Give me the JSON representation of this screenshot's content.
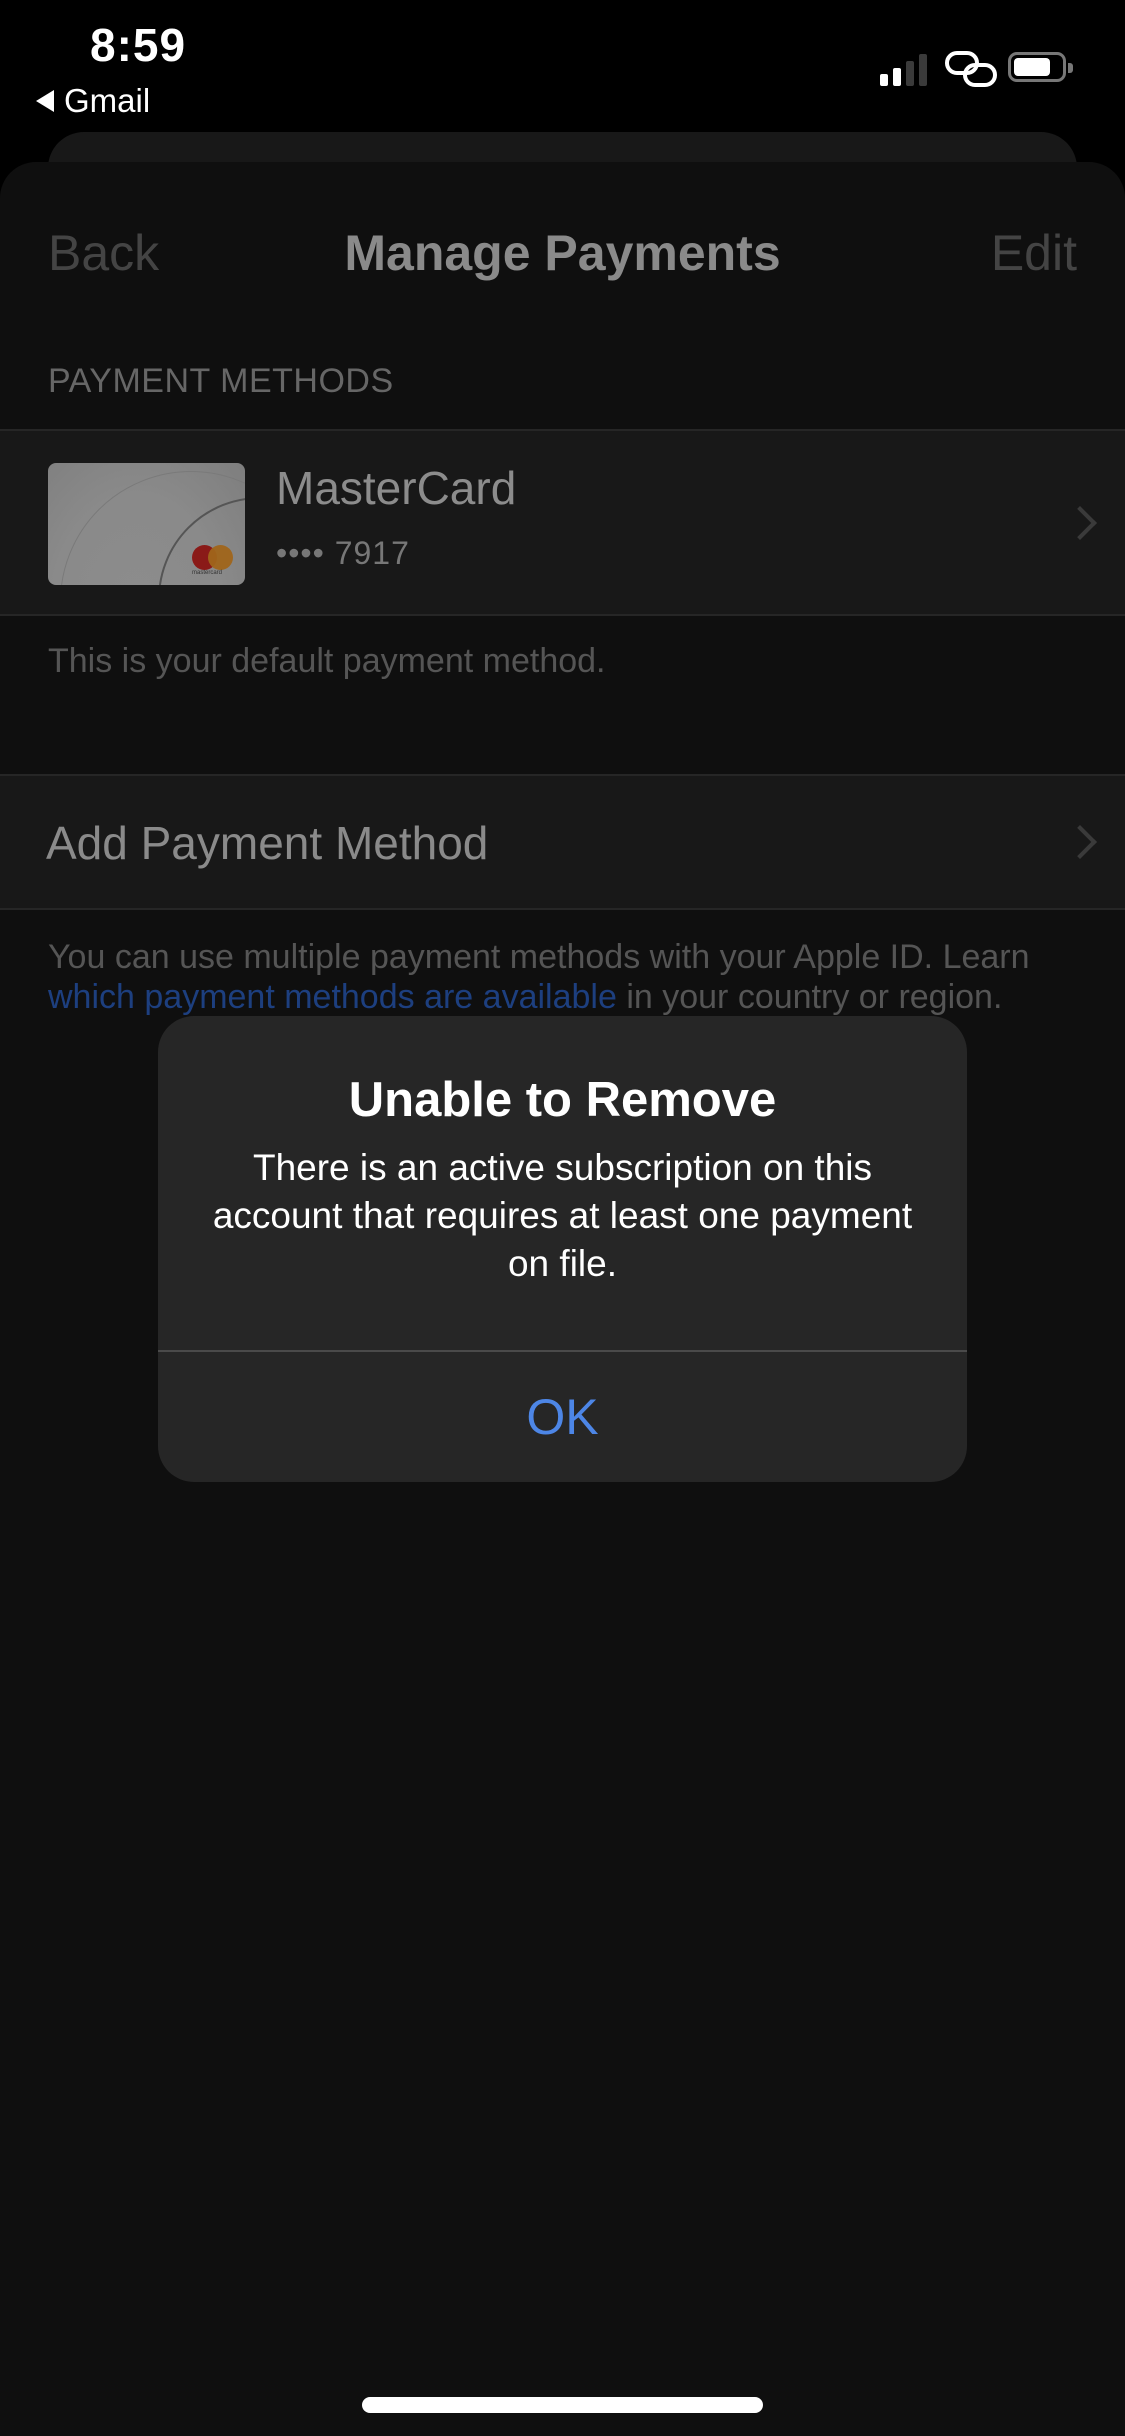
{
  "status_bar": {
    "time": "8:59",
    "back_app": "Gmail",
    "signal_bars_active": 2,
    "signal_bars_total": 4,
    "battery_level": 0.7,
    "icons": [
      "signal-icon",
      "link-icon",
      "battery-icon"
    ]
  },
  "nav": {
    "back_label": "Back",
    "title": "Manage Payments",
    "edit_label": "Edit"
  },
  "payment_methods": {
    "section_header": "PAYMENT METHODS",
    "cards": [
      {
        "name": "MasterCard",
        "masked_number": "•••• 7917",
        "brand": "mastercard",
        "logo_text": "mastercard"
      }
    ],
    "default_note": "This is your default payment method."
  },
  "add_payment": {
    "label": "Add Payment Method"
  },
  "footer": {
    "text_before": "You can use multiple payment methods with your Apple ID. Learn ",
    "link_text": "which payment methods are available",
    "text_after": " in your country or region."
  },
  "alert": {
    "title": "Unable to Remove",
    "message": "There is an active subscription on this account that requires at least one payment on file.",
    "ok_label": "OK"
  },
  "colors": {
    "accent_blue": "#4d86e6",
    "link_blue_dimmed": "#1d3f7f",
    "background": "#0f0f0f",
    "alert_bg": "#262626"
  }
}
